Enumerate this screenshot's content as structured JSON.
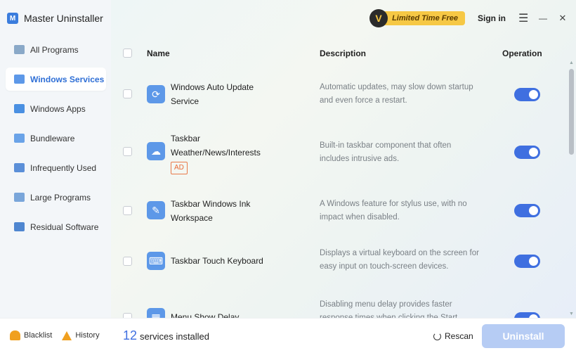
{
  "app": {
    "logo_letter": "M",
    "title": "Master Uninstaller"
  },
  "sidebar": {
    "items": [
      {
        "label": "All Programs",
        "icon": "monitor-icon",
        "color": "#8aa9c8",
        "active": false
      },
      {
        "label": "Windows Services",
        "icon": "windows-grid-icon",
        "color": "#5d98e8",
        "active": true
      },
      {
        "label": "Windows Apps",
        "icon": "apps-icon",
        "color": "#4a90e2",
        "active": false
      },
      {
        "label": "Bundleware",
        "icon": "bundle-icon",
        "color": "#6aa3e8",
        "active": false
      },
      {
        "label": "Infrequently Used",
        "icon": "calendar-icon",
        "color": "#5b8fd8",
        "active": false
      },
      {
        "label": "Large Programs",
        "icon": "large-program-icon",
        "color": "#7aa6da",
        "active": false
      },
      {
        "label": "Residual Software",
        "icon": "residual-icon",
        "color": "#4f86d0",
        "active": false
      }
    ]
  },
  "topbar": {
    "promo_letter": "V",
    "promo_label": "Limited Time Free",
    "signin": "Sign in",
    "menu_glyph": "☰",
    "minimize_glyph": "—",
    "close_glyph": "✕"
  },
  "table": {
    "headers": {
      "name": "Name",
      "description": "Description",
      "operation": "Operation"
    },
    "rows": [
      {
        "name": "Windows Auto Update Service",
        "description": "Automatic updates, may slow down startup and even force a restart.",
        "icon": "refresh-icon",
        "glyph": "⟳",
        "ad": "",
        "enabled": true
      },
      {
        "name": "Taskbar Weather/News/Interests",
        "description": "Built-in taskbar component that often includes intrusive ads.",
        "icon": "cloud-icon",
        "glyph": "☁",
        "ad": "AD",
        "enabled": true
      },
      {
        "name": "Taskbar Windows Ink Workspace",
        "description": "A Windows feature for stylus use, with no impact when disabled.",
        "icon": "pen-icon",
        "glyph": "✎",
        "ad": "",
        "enabled": true
      },
      {
        "name": "Taskbar Touch Keyboard",
        "description": "Displays a virtual keyboard on the screen for easy input on touch-screen devices.",
        "icon": "keyboard-icon",
        "glyph": "⌨",
        "ad": "",
        "enabled": true
      },
      {
        "name": "Menu Show Delay",
        "description": "Disabling menu delay provides faster response times when clicking the Start",
        "icon": "menu-grid-icon",
        "glyph": "▦",
        "ad": "",
        "enabled": true
      }
    ]
  },
  "footer": {
    "blacklist": "Blacklist",
    "history": "History",
    "count": "12",
    "count_label": "services installed",
    "rescan": "Rescan",
    "uninstall": "Uninstall"
  },
  "colors": {
    "accent": "#3f6fe0",
    "promo": "#f6c845",
    "uninstall_disabled": "#b6ccf4"
  }
}
